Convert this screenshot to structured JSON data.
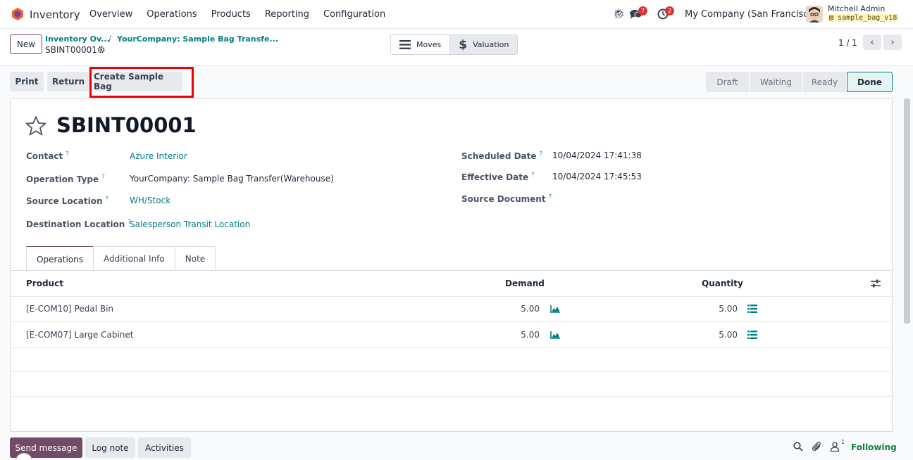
{
  "navbar": {
    "app_name": "Inventory",
    "menu": [
      "Overview",
      "Operations",
      "Products",
      "Reporting",
      "Configuration"
    ],
    "chat_count": "7",
    "activity_count": "2",
    "company": "My Company (San Francisco)",
    "user_name": "Mitchell Admin",
    "database": "sample_bag_v18"
  },
  "control_panel": {
    "new_label": "New",
    "breadcrumb_1": "Inventory Ov...",
    "breadcrumb_sep": "/",
    "breadcrumb_2": "YourCompany: Sample Bag Transfe...",
    "record_ref": "SBINT00001",
    "smart_buttons": {
      "moves": "Moves",
      "valuation": "Valuation"
    },
    "pager": "1 / 1"
  },
  "status_actions": {
    "print": "Print",
    "return": "Return",
    "create_sample_bag": "Create Sample Bag"
  },
  "states": [
    "Draft",
    "Waiting",
    "Ready",
    "Done"
  ],
  "active_state": "Done",
  "form": {
    "title": "SBINT00001",
    "fields_left": [
      {
        "label": "Contact",
        "value": "Azure Interior"
      },
      {
        "label": "Operation Type",
        "value": "YourCompany: Sample Bag Transfer(Warehouse)"
      },
      {
        "label": "Source Location",
        "value": "WH/Stock"
      },
      {
        "label": "Destination Location",
        "value": "Salesperson Transit Location"
      }
    ],
    "fields_right": [
      {
        "label": "Scheduled Date",
        "value": "10/04/2024 17:41:38"
      },
      {
        "label": "Effective Date",
        "value": "10/04/2024 17:45:53"
      },
      {
        "label": "Source Document",
        "value": ""
      }
    ],
    "help_mark": "?"
  },
  "tabs": [
    "Operations",
    "Additional Info",
    "Note"
  ],
  "table": {
    "headers": {
      "product": "Product",
      "demand": "Demand",
      "quantity": "Quantity"
    },
    "rows": [
      {
        "product": "[E-COM10] Pedal Bin",
        "demand": "5.00",
        "quantity": "5.00"
      },
      {
        "product": "[E-COM07] Large Cabinet",
        "demand": "5.00",
        "quantity": "5.00"
      }
    ]
  },
  "chatter": {
    "send_message": "Send message",
    "log_note": "Log note",
    "activities": "Activities",
    "followers_count": "1",
    "following": "Following"
  },
  "colors": {
    "brand": "#714b67",
    "link": "#017e84",
    "highlight": "#ee0000",
    "following": "#15803d"
  }
}
